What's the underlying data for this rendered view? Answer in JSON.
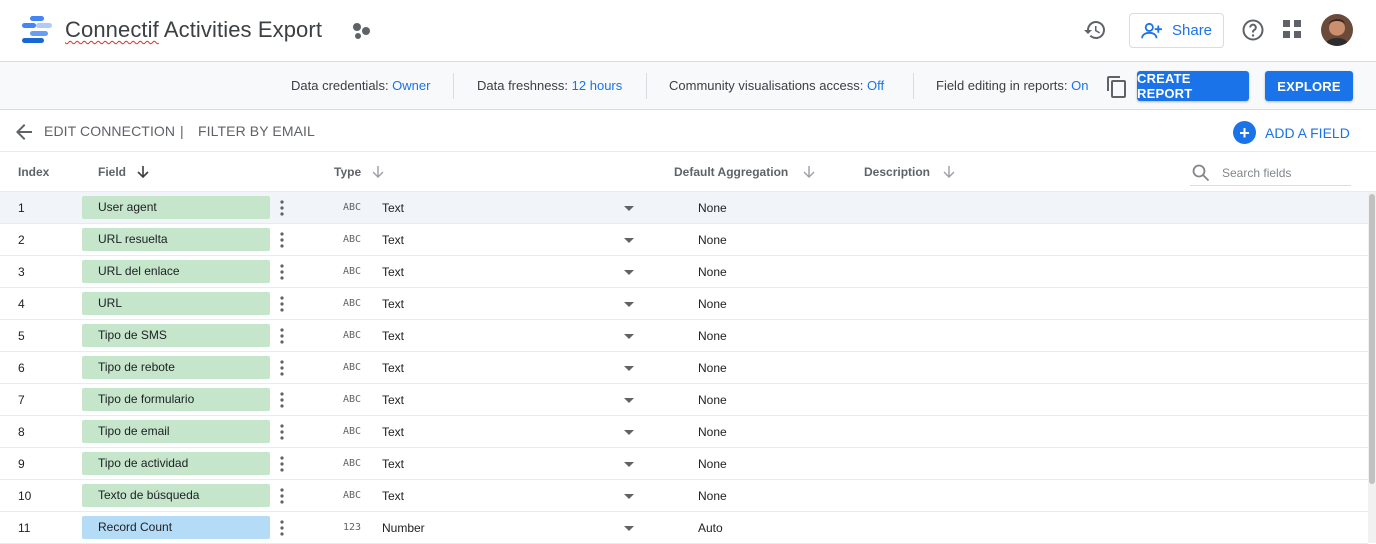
{
  "header": {
    "title_main": "Connectif",
    "title_rest": " Activities Export",
    "share_label": "Share"
  },
  "infobar": {
    "credentials_label": "Data credentials: ",
    "credentials_value": "Owner",
    "freshness_label": "Data freshness: ",
    "freshness_value": "12 hours",
    "community_label": "Community visualisations access: ",
    "community_value": "Off",
    "field_editing_label": "Field editing in reports: ",
    "field_editing_value": "On",
    "create_report_label": "CREATE REPORT",
    "explore_label": "EXPLORE"
  },
  "actionbar": {
    "edit_connection": "EDIT CONNECTION",
    "separator": "|",
    "filter_by_email": "FILTER BY EMAIL",
    "add_field": "ADD A FIELD"
  },
  "table": {
    "columns": {
      "index": "Index",
      "field": "Field",
      "type": "Type",
      "aggregation": "Default Aggregation",
      "description": "Description"
    },
    "search_placeholder": "Search fields",
    "rows": [
      {
        "index": "1",
        "field": "User agent",
        "kind": "dimension",
        "type_icon": "ABC",
        "type": "Text",
        "aggregation": "None"
      },
      {
        "index": "2",
        "field": "URL resuelta",
        "kind": "dimension",
        "type_icon": "ABC",
        "type": "Text",
        "aggregation": "None"
      },
      {
        "index": "3",
        "field": "URL del enlace",
        "kind": "dimension",
        "type_icon": "ABC",
        "type": "Text",
        "aggregation": "None"
      },
      {
        "index": "4",
        "field": "URL",
        "kind": "dimension",
        "type_icon": "ABC",
        "type": "Text",
        "aggregation": "None"
      },
      {
        "index": "5",
        "field": "Tipo de SMS",
        "kind": "dimension",
        "type_icon": "ABC",
        "type": "Text",
        "aggregation": "None"
      },
      {
        "index": "6",
        "field": "Tipo de rebote",
        "kind": "dimension",
        "type_icon": "ABC",
        "type": "Text",
        "aggregation": "None"
      },
      {
        "index": "7",
        "field": "Tipo de formulario",
        "kind": "dimension",
        "type_icon": "ABC",
        "type": "Text",
        "aggregation": "None"
      },
      {
        "index": "8",
        "field": "Tipo de email",
        "kind": "dimension",
        "type_icon": "ABC",
        "type": "Text",
        "aggregation": "None"
      },
      {
        "index": "9",
        "field": "Tipo de actividad",
        "kind": "dimension",
        "type_icon": "ABC",
        "type": "Text",
        "aggregation": "None"
      },
      {
        "index": "10",
        "field": "Texto de búsqueda",
        "kind": "dimension",
        "type_icon": "ABC",
        "type": "Text",
        "aggregation": "None"
      },
      {
        "index": "11",
        "field": "Record Count",
        "kind": "metric",
        "type_icon": "123",
        "type": "Number",
        "aggregation": "Auto"
      }
    ]
  },
  "colors": {
    "accent": "#1a73e8",
    "dimension_field": "#c6e6cc",
    "metric_field": "#b5dcf7"
  },
  "icons": [
    "data-studio-logo-icon",
    "data-source-icon",
    "history-icon",
    "person-add-icon",
    "help-icon",
    "apps-grid-icon",
    "copy-icon",
    "arrow-back-icon",
    "add-circle-icon",
    "sort-arrow-icon",
    "search-icon",
    "more-vert-icon",
    "dropdown-caret-icon"
  ]
}
